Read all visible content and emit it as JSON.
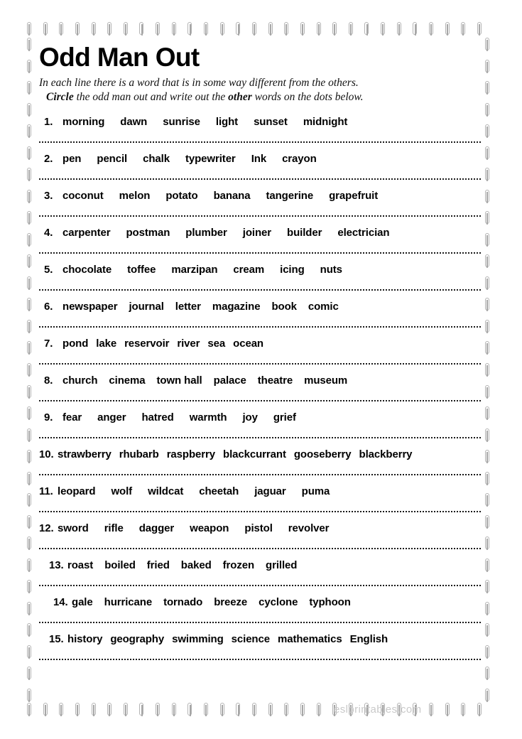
{
  "page": {
    "title": "Odd Man Out",
    "instructions_line1": "In each line there is a word that is in some way different from the others.",
    "instructions_line2_pre": "",
    "instructions_bold1": "Circle",
    "instructions_mid": " the odd man out and write out the ",
    "instructions_bold2": "other",
    "instructions_post": " words on the dots below.",
    "watermark": "eslprintables.com"
  },
  "border": {
    "clip_icon": "paperclip-icon",
    "clip_color": "#b3b3b3",
    "top_count": 29,
    "bottom_count": 29,
    "left_count": 31,
    "right_count": 31
  },
  "questions": [
    {
      "number": "1.",
      "words": [
        "morning",
        "dawn",
        "sunrise",
        "light",
        "sunset",
        "midnight"
      ],
      "indent": "indent-1",
      "gap": "gap-wide"
    },
    {
      "number": "2.",
      "words": [
        "pen",
        "pencil",
        "chalk",
        "typewriter",
        "Ink",
        "crayon"
      ],
      "indent": "indent-1",
      "gap": "gap-wide"
    },
    {
      "number": "3.",
      "words": [
        "coconut",
        "melon",
        "potato",
        "banana",
        "tangerine",
        "grapefruit"
      ],
      "indent": "indent-1",
      "gap": "gap-wide"
    },
    {
      "number": "4.",
      "words": [
        "carpenter",
        "postman",
        "plumber",
        "joiner",
        "builder",
        "electrician"
      ],
      "indent": "indent-1",
      "gap": "gap-wide"
    },
    {
      "number": "5.",
      "words": [
        "chocolate",
        "toffee",
        "marzipan",
        "cream",
        "icing",
        "nuts"
      ],
      "indent": "indent-1",
      "gap": "gap-wide"
    },
    {
      "number": "6.",
      "words": [
        "newspaper",
        "journal",
        "letter",
        "magazine",
        "book",
        "comic"
      ],
      "indent": "indent-1",
      "gap": ""
    },
    {
      "number": "7.",
      "words": [
        "pond",
        "lake",
        "reservoir",
        "river",
        "sea",
        "ocean"
      ],
      "indent": "indent-1",
      "gap": "gap-narrow"
    },
    {
      "number": "8.",
      "words": [
        "church",
        "cinema",
        "town hall",
        "palace",
        "theatre",
        "museum"
      ],
      "indent": "indent-1",
      "gap": ""
    },
    {
      "number": "9.",
      "words": [
        "fear",
        "anger",
        "hatred",
        "warmth",
        "joy",
        "grief"
      ],
      "indent": "indent-1",
      "gap": "gap-wide"
    },
    {
      "number": "10.",
      "words": [
        "strawberry",
        "rhubarb",
        "raspberry",
        "blackcurrant",
        "gooseberry",
        "blackberry"
      ],
      "indent": "",
      "gap": "gap-narrow"
    },
    {
      "number": "11.",
      "words": [
        "leopard",
        "wolf",
        "wildcat",
        "cheetah",
        "jaguar",
        "puma"
      ],
      "indent": "",
      "gap": "gap-wide"
    },
    {
      "number": "12.",
      "words": [
        "sword",
        "rifle",
        "dagger",
        "weapon",
        "pistol",
        "revolver"
      ],
      "indent": "",
      "gap": "gap-wide"
    },
    {
      "number": "13.",
      "words": [
        "roast",
        "boiled",
        "fried",
        "baked",
        "frozen",
        "grilled"
      ],
      "indent": "indent-2",
      "gap": ""
    },
    {
      "number": "14.",
      "words": [
        "gale",
        "hurricane",
        "tornado",
        "breeze",
        "cyclone",
        "typhoon"
      ],
      "indent": "indent-3",
      "gap": ""
    },
    {
      "number": "15.",
      "words": [
        "history",
        "geography",
        "swimming",
        "science",
        "mathematics",
        "English"
      ],
      "indent": "indent-2",
      "gap": "gap-narrow"
    }
  ]
}
